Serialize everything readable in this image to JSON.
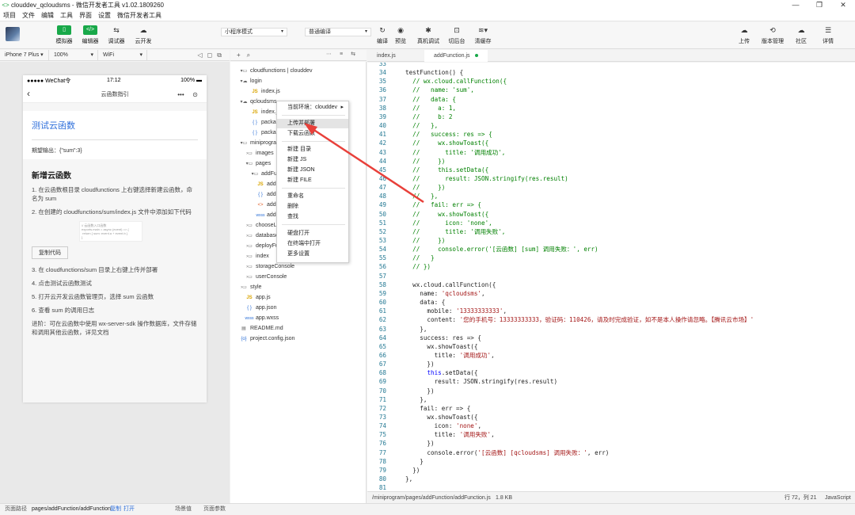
{
  "window": {
    "title": "clouddev_qcloudsms - 微信开发者工具 v1.02.1809260",
    "controls": [
      "—",
      "❐",
      "✕"
    ]
  },
  "menubar": [
    "项目",
    "文件",
    "编辑",
    "工具",
    "界面",
    "设置",
    "微信开发者工具"
  ],
  "toolbar": {
    "left_buttons": [
      "模拟器",
      "编辑器",
      "调试器",
      "云开发"
    ],
    "mode_select": "小程序模式",
    "compile_select": "普通编译",
    "mid_buttons": [
      "编译",
      "预览",
      "真机调试",
      "切后台",
      "清缓存"
    ],
    "right_buttons": [
      "上传",
      "版本管理",
      "社区",
      "详情"
    ]
  },
  "simulator": {
    "device": "iPhone 7 Plus",
    "zoom": "100%",
    "network": "WiFi",
    "status_carrier": "●●●●● WeChat令",
    "status_time": "17:12",
    "status_battery": "100% ▬",
    "nav_title": "云函数指引",
    "card_title": "测试云函数",
    "expected_output": "期望输出：{\"sum\":3}",
    "section_title": "新增云函数",
    "steps": [
      "1. 在云函数根目录 cloudfunctions 上右键选择新建云函数，命名为 sum",
      "2. 在创建的 cloudfunctions/sum/index.js 文件中添加如下代码"
    ],
    "copy_button": "复制代码",
    "steps_after": [
      "3. 在 cloudfunctions/sum 目录上右键上传并部署",
      "4. 点击测试云函数测试",
      "5. 打开云开发云函数管理页，选择 sum 云函数",
      "6. 查看 sum 的调用日志",
      "进阶：可在云函数中使用 wx-server-sdk 操作数据库，文件存储和调用其他云函数，详见文档"
    ]
  },
  "explorer": {
    "tree": [
      {
        "label": "cloudfunctions | clouddev",
        "icon": "▾▭"
      },
      {
        "label": "login",
        "icon": "▾☁"
      },
      {
        "label": "index.js",
        "icon": "JS"
      },
      {
        "label": "qcloudsms",
        "icon": "▾☁"
      },
      {
        "label": "index.js",
        "icon": "JS"
      },
      {
        "label": "package.json",
        "icon": "{ }"
      },
      {
        "label": "package-lock.json",
        "icon": "{ }"
      },
      {
        "label": "miniprogram",
        "icon": "▾▭"
      },
      {
        "label": "images",
        "icon": "›▭"
      },
      {
        "label": "pages",
        "icon": "▾▭"
      },
      {
        "label": "addFunction",
        "icon": "▾▭"
      },
      {
        "label": "addFunction.js",
        "icon": "JS"
      },
      {
        "label": "addFunction.json",
        "icon": "{ }"
      },
      {
        "label": "addFunction.wxml",
        "icon": "<>"
      },
      {
        "label": "addFunction.wxss",
        "icon": "wxss"
      },
      {
        "label": "chooseLib",
        "icon": "›▭"
      },
      {
        "label": "databaseGuide",
        "icon": "›▭"
      },
      {
        "label": "deployFunctions",
        "icon": "›▭"
      },
      {
        "label": "index",
        "icon": "›▭"
      },
      {
        "label": "storageConsole",
        "icon": "›▭"
      },
      {
        "label": "userConsole",
        "icon": "›▭"
      },
      {
        "label": "style",
        "icon": "›▭"
      },
      {
        "label": "app.js",
        "icon": "JS"
      },
      {
        "label": "app.json",
        "icon": "{ }"
      },
      {
        "label": "app.wxss",
        "icon": "wxss"
      },
      {
        "label": "README.md",
        "icon": "▤"
      },
      {
        "label": "project.config.json",
        "icon": "{o}"
      }
    ]
  },
  "context_menu": {
    "items": [
      "当前环境：clouddev",
      "上传并部署",
      "下载云函数",
      "新建 目录",
      "新建 JS",
      "新建 JSON",
      "新建 FILE",
      "重命名",
      "删除",
      "查找",
      "硬盘打开",
      "在终端中打开",
      "更多设置"
    ],
    "highlighted_index": 1
  },
  "editor": {
    "tabs": [
      "index.js",
      "addFunction.js"
    ],
    "active_tab": 1,
    "first_line": 33,
    "lines": [
      "",
      "testFunction() {",
      "  // wx.cloud.callFunction({",
      "  //   name: 'sum',",
      "  //   data: {",
      "  //     a: 1,",
      "  //     b: 2",
      "  //   },",
      "  //   success: res => {",
      "  //     wx.showToast({",
      "  //       title: '调用成功',",
      "  //     })",
      "  //     this.setData({",
      "  //       result: JSON.stringify(res.result)",
      "  //     })",
      "  //   },",
      "  //   fail: err => {",
      "  //     wx.showToast({",
      "  //       icon: 'none',",
      "  //       title: '调用失败',",
      "  //     })",
      "  //     console.error('[云函数] [sum] 调用失败：', err)",
      "  //   }",
      "  // })",
      "",
      "  wx.cloud.callFunction({",
      "    name: 'qcloudsms',",
      "    data: {",
      "      mobile: '13333333333',",
      "      content: '您的手机号：13333333333，验证码：110426，请及时完成验证，如不是本人操作请忽略。【腾讯云市场】'",
      "    },",
      "    success: res => {",
      "      wx.showToast({",
      "        title: '调用成功',",
      "      })",
      "      this.setData({",
      "        result: JSON.stringify(res.result)",
      "      })",
      "    },",
      "    fail: err => {",
      "      wx.showToast({",
      "        icon: 'none',",
      "        title: '调用失败',",
      "      })",
      "      console.error('[云函数] [qcloudsms] 调用失败：', err)",
      "    }",
      "  })",
      "},",
      ""
    ]
  },
  "status_bar": {
    "path": "/miniprogram/pages/addFunction/addFunction.js",
    "size": "1.8 KB",
    "position": "行 72，列 21",
    "language": "JavaScript"
  },
  "bottom_bar": {
    "page_path_label": "页面路径",
    "page_path": "pages/addFunction/addFunction",
    "copy": "复制",
    "open": "打开",
    "scene": "场景值",
    "params": "页面参数"
  },
  "colors": {
    "accent_green": "#18a849",
    "annotation_red": "#e8403a",
    "comment": "#008000",
    "string": "#a31515",
    "line_number": "#237893"
  }
}
